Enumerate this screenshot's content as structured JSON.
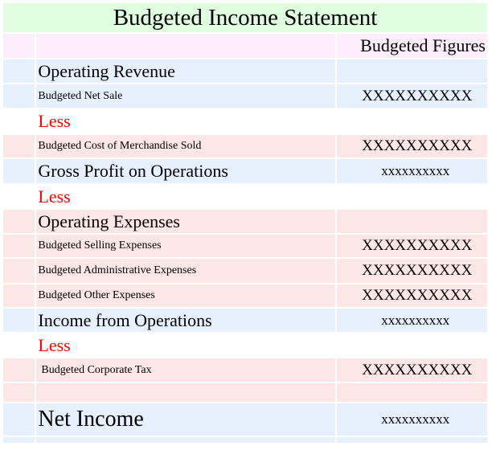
{
  "title": "Budgeted Income Statement",
  "column_header": "Budgeted Figures",
  "colors": {
    "title_bg": "#e0ffe0",
    "header_bg": "#fdeefd",
    "blue_row_bg": "#e6f1fd",
    "pink_row_bg": "#fde6e6",
    "less_text": "#ff0000"
  },
  "rows": [
    {
      "label": "Operating Revenue",
      "value": ""
    },
    {
      "label": "Budgeted Net Sale",
      "value": "XXXXXXXXXX"
    },
    {
      "label": "Less",
      "value": ""
    },
    {
      "label": "Budgeted Cost of Merchandise Sold",
      "value": "XXXXXXXXXX"
    },
    {
      "label": "Gross Profit on Operations",
      "value": "xxxxxxxxxx"
    },
    {
      "label": "Less",
      "value": ""
    },
    {
      "label": "Operating Expenses",
      "value": ""
    },
    {
      "label": "Budgeted Selling Expenses",
      "value": "XXXXXXXXXX"
    },
    {
      "label": "Budgeted Administrative Expenses",
      "value": "XXXXXXXXXX"
    },
    {
      "label": "Budgeted Other Expenses",
      "value": "XXXXXXXXXX"
    },
    {
      "label": "Income from Operations",
      "value": "xxxxxxxxxx"
    },
    {
      "label": "Less",
      "value": ""
    },
    {
      "label": "Budgeted Corporate Tax",
      "value": "XXXXXXXXXX"
    },
    {
      "label": "",
      "value": ""
    },
    {
      "label": "Net Income",
      "value": "xxxxxxxxxx"
    },
    {
      "label": "",
      "value": ""
    }
  ]
}
